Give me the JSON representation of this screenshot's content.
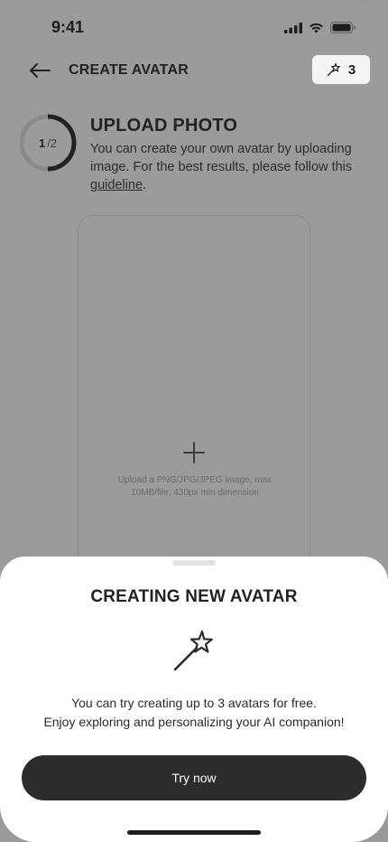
{
  "status_bar": {
    "time": "9:41"
  },
  "header": {
    "title": "CREATE AVATAR",
    "credits_count": "3",
    "icons": {
      "back": "arrow-left-icon",
      "credits": "magic-wand-icon"
    }
  },
  "step": {
    "current": "1",
    "total": "/2",
    "progress_fraction": 0.5
  },
  "upload_section": {
    "title": "UPLOAD PHOTO",
    "description": "You can create your own avatar by uploading image.  For the best results, please follow this ",
    "link_text": "guideline",
    "description_end": ".",
    "hint": "Upload a PNG/JPG/JPEG image, max 10MB/file, 430px min dimension"
  },
  "sheet": {
    "title": "CREATING NEW AVATAR",
    "message_line1": "You can try creating up to 3 avatars for free.",
    "message_line2": "Enjoy exploring and personalizing your AI companion!",
    "cta_label": "Try now"
  },
  "colors": {
    "overlay_bg": "#9b9b9b",
    "sheet_bg": "#ffffff",
    "primary_button": "#2c2c2c",
    "text": "#222222"
  }
}
